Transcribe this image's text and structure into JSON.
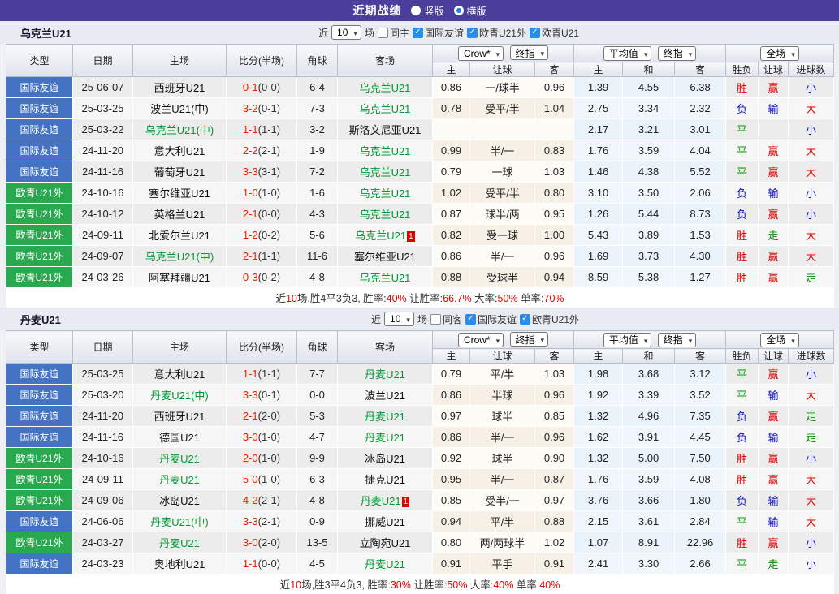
{
  "header_bar": {
    "title": "近期战绩",
    "vertical": "竖版",
    "horizontal": "横版"
  },
  "columns": {
    "type": "类型",
    "date": "日期",
    "home": "主场",
    "score": "比分(半场)",
    "corner": "角球",
    "away": "客场",
    "crow": "Crow*",
    "final": "终指",
    "average": "平均值",
    "final2": "终指",
    "fulltime": "全场",
    "sub_home": "主",
    "sub_handicap": "让球",
    "sub_away": "客",
    "sub_avg_home": "主",
    "sub_draw": "和",
    "sub_avg_away": "客",
    "sub_wdl": "胜负",
    "sub_handicap2": "让球",
    "sub_goals": "进球数"
  },
  "colors": {
    "topbar": "#4a3e9c",
    "type_blue": "#4573c4",
    "type_green": "#29a94e",
    "red": "#e00000",
    "green": "#0a8a0a",
    "blue": "#1111cc",
    "focus_team": "#009933",
    "score_red": "#ee2200"
  },
  "tables": [
    {
      "team": "乌克兰U21",
      "filter": {
        "near": "近",
        "count": "10",
        "games": "场",
        "same": "同主",
        "cb1": "国际友谊",
        "cb2": "欧青U21外",
        "cb3": "欧青U21"
      },
      "rows": [
        {
          "type": "国际友谊",
          "tc": "b",
          "date": "25-06-07",
          "home": "西班牙U21",
          "hg": 0,
          "hb": "",
          "ft": "0-1",
          "ht": "(0-0)",
          "cn": "6-4",
          "away": "乌克兰U21",
          "ag": 1,
          "ab": "",
          "ch": "0.86",
          "hc": "一/球半",
          "ca": "0.96",
          "ah": "1.39",
          "ad": "4.55",
          "aa": "6.38",
          "w1": "胜",
          "k1": "r",
          "w2": "赢",
          "k2": "r",
          "w3": "小",
          "k3": "b"
        },
        {
          "type": "国际友谊",
          "tc": "b",
          "date": "25-03-25",
          "home": "波兰U21(中)",
          "hg": 0,
          "hb": "",
          "ft": "3-2",
          "ht": "(0-1)",
          "cn": "7-3",
          "away": "乌克兰U21",
          "ag": 1,
          "ab": "",
          "ch": "0.78",
          "hc": "受平/半",
          "ca": "1.04",
          "ah": "2.75",
          "ad": "3.34",
          "aa": "2.32",
          "w1": "负",
          "k1": "b",
          "w2": "输",
          "k2": "b",
          "w3": "大",
          "k3": "r"
        },
        {
          "type": "国际友谊",
          "tc": "b",
          "date": "25-03-22",
          "home": "乌克兰U21(中)",
          "hg": 1,
          "hb": "",
          "ft": "1-1",
          "ht": "(1-1)",
          "cn": "3-2",
          "away": "斯洛文尼亚U21",
          "ag": 0,
          "ab": "",
          "ch": "",
          "hc": "",
          "ca": "",
          "ah": "2.17",
          "ad": "3.21",
          "aa": "3.01",
          "w1": "平",
          "k1": "g",
          "w2": "",
          "k2": "",
          "w3": "小",
          "k3": "b"
        },
        {
          "type": "国际友谊",
          "tc": "b",
          "date": "24-11-20",
          "home": "意大利U21",
          "hg": 0,
          "hb": "",
          "ft": "2-2",
          "ht": "(2-1)",
          "cn": "1-9",
          "away": "乌克兰U21",
          "ag": 1,
          "ab": "",
          "ch": "0.99",
          "hc": "半/一",
          "ca": "0.83",
          "ah": "1.76",
          "ad": "3.59",
          "aa": "4.04",
          "w1": "平",
          "k1": "g",
          "w2": "赢",
          "k2": "r",
          "w3": "大",
          "k3": "r"
        },
        {
          "type": "国际友谊",
          "tc": "b",
          "date": "24-11-16",
          "home": "葡萄牙U21",
          "hg": 0,
          "hb": "",
          "ft": "3-3",
          "ht": "(3-1)",
          "cn": "7-2",
          "away": "乌克兰U21",
          "ag": 1,
          "ab": "",
          "ch": "0.79",
          "hc": "一球",
          "ca": "1.03",
          "ah": "1.46",
          "ad": "4.38",
          "aa": "5.52",
          "w1": "平",
          "k1": "g",
          "w2": "赢",
          "k2": "r",
          "w3": "大",
          "k3": "r"
        },
        {
          "type": "欧青U21外",
          "tc": "g",
          "date": "24-10-16",
          "home": "塞尔维亚U21",
          "hg": 0,
          "hb": "",
          "ft": "1-0",
          "ht": "(1-0)",
          "cn": "1-6",
          "away": "乌克兰U21",
          "ag": 1,
          "ab": "",
          "ch": "1.02",
          "hc": "受平/半",
          "ca": "0.80",
          "ah": "3.10",
          "ad": "3.50",
          "aa": "2.06",
          "w1": "负",
          "k1": "b",
          "w2": "输",
          "k2": "b",
          "w3": "小",
          "k3": "b"
        },
        {
          "type": "欧青U21外",
          "tc": "g",
          "date": "24-10-12",
          "home": "英格兰U21",
          "hg": 0,
          "hb": "",
          "ft": "2-1",
          "ht": "(0-0)",
          "cn": "4-3",
          "away": "乌克兰U21",
          "ag": 1,
          "ab": "",
          "ch": "0.87",
          "hc": "球半/两",
          "ca": "0.95",
          "ah": "1.26",
          "ad": "5.44",
          "aa": "8.73",
          "w1": "负",
          "k1": "b",
          "w2": "赢",
          "k2": "r",
          "w3": "小",
          "k3": "b"
        },
        {
          "type": "欧青U21外",
          "tc": "g",
          "date": "24-09-11",
          "home": "北爱尔兰U21",
          "hg": 0,
          "hb": "",
          "ft": "1-2",
          "ht": "(0-2)",
          "cn": "5-6",
          "away": "乌克兰U21",
          "ag": 1,
          "ab": "1",
          "ch": "0.82",
          "hc": "受一球",
          "ca": "1.00",
          "ah": "5.43",
          "ad": "3.89",
          "aa": "1.53",
          "w1": "胜",
          "k1": "r",
          "w2": "走",
          "k2": "g",
          "w3": "大",
          "k3": "r"
        },
        {
          "type": "欧青U21外",
          "tc": "g",
          "date": "24-09-07",
          "home": "乌克兰U21(中)",
          "hg": 1,
          "hb": "",
          "ft": "2-1",
          "ht": "(1-1)",
          "cn": "11-6",
          "away": "塞尔维亚U21",
          "ag": 0,
          "ab": "",
          "ch": "0.86",
          "hc": "半/一",
          "ca": "0.96",
          "ah": "1.69",
          "ad": "3.73",
          "aa": "4.30",
          "w1": "胜",
          "k1": "r",
          "w2": "赢",
          "k2": "r",
          "w3": "大",
          "k3": "r"
        },
        {
          "type": "欧青U21外",
          "tc": "g",
          "date": "24-03-26",
          "home": "阿塞拜疆U21",
          "hg": 0,
          "hb": "",
          "ft": "0-3",
          "ht": "(0-2)",
          "cn": "4-8",
          "away": "乌克兰U21",
          "ag": 1,
          "ab": "",
          "ch": "0.88",
          "hc": "受球半",
          "ca": "0.94",
          "ah": "8.59",
          "ad": "5.38",
          "aa": "1.27",
          "w1": "胜",
          "k1": "r",
          "w2": "赢",
          "k2": "r",
          "w3": "走",
          "k3": "g"
        }
      ],
      "summary": [
        [
          "近",
          0
        ],
        [
          "10",
          1
        ],
        [
          "场,胜4平3负3, 胜率:",
          0
        ],
        [
          "40%",
          1
        ],
        [
          " 让胜率:",
          0
        ],
        [
          "66.7%",
          1
        ],
        [
          " 大率:",
          0
        ],
        [
          "50%",
          1
        ],
        [
          " 单率:",
          0
        ],
        [
          "70%",
          1
        ]
      ]
    },
    {
      "team": "丹麦U21",
      "filter": {
        "near": "近",
        "count": "10",
        "games": "场",
        "same": "同客",
        "cb1": "国际友谊",
        "cb2": "欧青U21外"
      },
      "rows": [
        {
          "type": "国际友谊",
          "tc": "b",
          "date": "25-03-25",
          "home": "意大利U21",
          "hg": 0,
          "hb": "",
          "ft": "1-1",
          "ht": "(1-1)",
          "cn": "7-7",
          "away": "丹麦U21",
          "ag": 1,
          "ab": "",
          "ch": "0.79",
          "hc": "平/半",
          "ca": "1.03",
          "ah": "1.98",
          "ad": "3.68",
          "aa": "3.12",
          "w1": "平",
          "k1": "g",
          "w2": "赢",
          "k2": "r",
          "w3": "小",
          "k3": "b"
        },
        {
          "type": "国际友谊",
          "tc": "b",
          "date": "25-03-20",
          "home": "丹麦U21(中)",
          "hg": 1,
          "hb": "",
          "ft": "3-3",
          "ht": "(0-1)",
          "cn": "0-0",
          "away": "波兰U21",
          "ag": 0,
          "ab": "",
          "ch": "0.86",
          "hc": "半球",
          "ca": "0.96",
          "ah": "1.92",
          "ad": "3.39",
          "aa": "3.52",
          "w1": "平",
          "k1": "g",
          "w2": "输",
          "k2": "b",
          "w3": "大",
          "k3": "r"
        },
        {
          "type": "国际友谊",
          "tc": "b",
          "date": "24-11-20",
          "home": "西班牙U21",
          "hg": 0,
          "hb": "",
          "ft": "2-1",
          "ht": "(2-0)",
          "cn": "5-3",
          "away": "丹麦U21",
          "ag": 1,
          "ab": "",
          "ch": "0.97",
          "hc": "球半",
          "ca": "0.85",
          "ah": "1.32",
          "ad": "4.96",
          "aa": "7.35",
          "w1": "负",
          "k1": "b",
          "w2": "赢",
          "k2": "r",
          "w3": "走",
          "k3": "g"
        },
        {
          "type": "国际友谊",
          "tc": "b",
          "date": "24-11-16",
          "home": "德国U21",
          "hg": 0,
          "hb": "",
          "ft": "3-0",
          "ht": "(1-0)",
          "cn": "4-7",
          "away": "丹麦U21",
          "ag": 1,
          "ab": "",
          "ch": "0.86",
          "hc": "半/一",
          "ca": "0.96",
          "ah": "1.62",
          "ad": "3.91",
          "aa": "4.45",
          "w1": "负",
          "k1": "b",
          "w2": "输",
          "k2": "b",
          "w3": "走",
          "k3": "g"
        },
        {
          "type": "欧青U21外",
          "tc": "g",
          "date": "24-10-16",
          "home": "丹麦U21",
          "hg": 1,
          "hb": "",
          "ft": "2-0",
          "ht": "(1-0)",
          "cn": "9-9",
          "away": "冰岛U21",
          "ag": 0,
          "ab": "",
          "ch": "0.92",
          "hc": "球半",
          "ca": "0.90",
          "ah": "1.32",
          "ad": "5.00",
          "aa": "7.50",
          "w1": "胜",
          "k1": "r",
          "w2": "赢",
          "k2": "r",
          "w3": "小",
          "k3": "b"
        },
        {
          "type": "欧青U21外",
          "tc": "g",
          "date": "24-09-11",
          "home": "丹麦U21",
          "hg": 1,
          "hb": "",
          "ft": "5-0",
          "ht": "(1-0)",
          "cn": "6-3",
          "away": "捷克U21",
          "ag": 0,
          "ab": "",
          "ch": "0.95",
          "hc": "半/一",
          "ca": "0.87",
          "ah": "1.76",
          "ad": "3.59",
          "aa": "4.08",
          "w1": "胜",
          "k1": "r",
          "w2": "赢",
          "k2": "r",
          "w3": "大",
          "k3": "r"
        },
        {
          "type": "欧青U21外",
          "tc": "g",
          "date": "24-09-06",
          "home": "冰岛U21",
          "hg": 0,
          "hb": "",
          "ft": "4-2",
          "ht": "(2-1)",
          "cn": "4-8",
          "away": "丹麦U21",
          "ag": 1,
          "ab": "1",
          "ch": "0.85",
          "hc": "受半/一",
          "ca": "0.97",
          "ah": "3.76",
          "ad": "3.66",
          "aa": "1.80",
          "w1": "负",
          "k1": "b",
          "w2": "输",
          "k2": "b",
          "w3": "大",
          "k3": "r"
        },
        {
          "type": "国际友谊",
          "tc": "b",
          "date": "24-06-06",
          "home": "丹麦U21(中)",
          "hg": 1,
          "hb": "",
          "ft": "3-3",
          "ht": "(2-1)",
          "cn": "0-9",
          "away": "挪威U21",
          "ag": 0,
          "ab": "",
          "ch": "0.94",
          "hc": "平/半",
          "ca": "0.88",
          "ah": "2.15",
          "ad": "3.61",
          "aa": "2.84",
          "w1": "平",
          "k1": "g",
          "w2": "输",
          "k2": "b",
          "w3": "大",
          "k3": "r"
        },
        {
          "type": "欧青U21外",
          "tc": "g",
          "date": "24-03-27",
          "home": "丹麦U21",
          "hg": 1,
          "hb": "",
          "ft": "3-0",
          "ht": "(2-0)",
          "cn": "13-5",
          "away": "立陶宛U21",
          "ag": 0,
          "ab": "",
          "ch": "0.80",
          "hc": "两/两球半",
          "ca": "1.02",
          "ah": "1.07",
          "ad": "8.91",
          "aa": "22.96",
          "w1": "胜",
          "k1": "r",
          "w2": "赢",
          "k2": "r",
          "w3": "小",
          "k3": "b"
        },
        {
          "type": "国际友谊",
          "tc": "b",
          "date": "24-03-23",
          "home": "奥地利U21",
          "hg": 0,
          "hb": "",
          "ft": "1-1",
          "ht": "(0-0)",
          "cn": "4-5",
          "away": "丹麦U21",
          "ag": 1,
          "ab": "",
          "ch": "0.91",
          "hc": "平手",
          "ca": "0.91",
          "ah": "2.41",
          "ad": "3.30",
          "aa": "2.66",
          "w1": "平",
          "k1": "g",
          "w2": "走",
          "k2": "g",
          "w3": "小",
          "k3": "b"
        }
      ],
      "summary": [
        [
          "近",
          0
        ],
        [
          "10",
          1
        ],
        [
          "场,胜3平4负3, 胜率:",
          0
        ],
        [
          "30%",
          1
        ],
        [
          " 让胜率:",
          0
        ],
        [
          "50%",
          1
        ],
        [
          " 大率:",
          0
        ],
        [
          "40%",
          1
        ],
        [
          " 单率:",
          0
        ],
        [
          "40%",
          1
        ]
      ]
    }
  ]
}
